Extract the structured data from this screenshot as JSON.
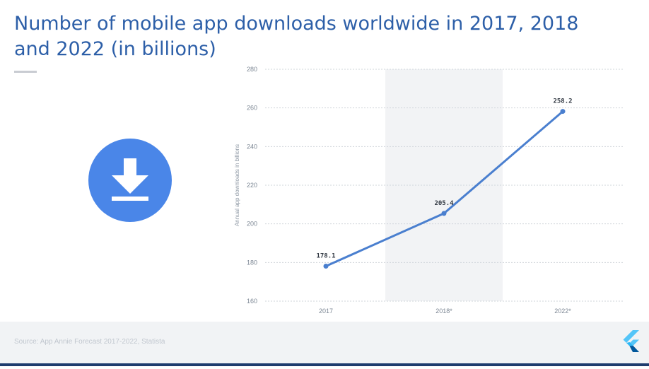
{
  "slide": {
    "title_line1": "Number of mobile app downloads worldwide in 2017, 2018",
    "title_line2": "and 2022 (in billions)",
    "source": "Source: App Annie Forecast 2017-2022, Statista"
  },
  "colors": {
    "title": "#2d5fa8",
    "line": "#4a7fcf",
    "badge": "#4a86e8",
    "highlight_band": "#f2f3f5",
    "footer_bar": "#1e3c6e"
  },
  "icons": {
    "badge": "download-icon",
    "logo": "flutter-logo-icon"
  },
  "chart_data": {
    "type": "line",
    "categories": [
      "2017",
      "2018*",
      "2022*"
    ],
    "series": [
      {
        "values": [
          178.1,
          205.4,
          258.2
        ]
      }
    ],
    "data_labels": [
      "178.1",
      "205.4",
      "258.2"
    ],
    "ylabel": "Annual app downloads in billions",
    "ylim": [
      160,
      280
    ],
    "yticks": [
      160,
      180,
      200,
      220,
      240,
      260,
      280
    ],
    "grid": true,
    "highlighted_category": "2018*"
  }
}
